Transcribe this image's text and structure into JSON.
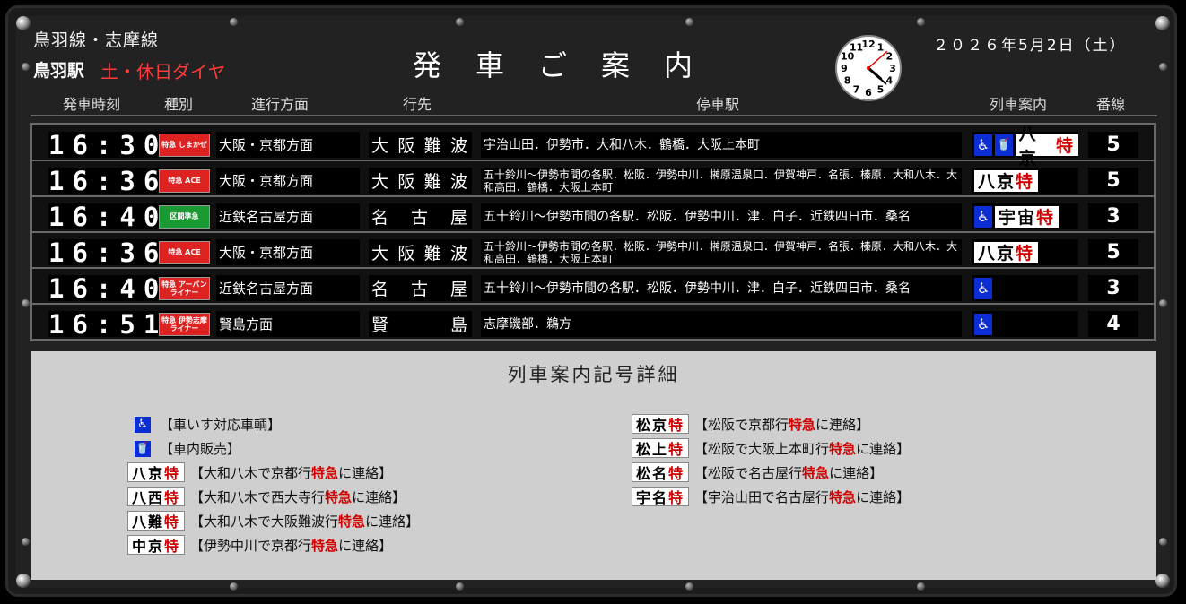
{
  "header": {
    "line_name": "鳥羽線・志摩線",
    "station": "鳥羽駅",
    "schedule": "土・休日ダイヤ",
    "title": "発車ご案内",
    "date": "２０２６年5月2日（土）"
  },
  "clock": {
    "numbers": [
      "12",
      "1",
      "2",
      "3",
      "4",
      "5",
      "6",
      "7",
      "8",
      "9",
      "10",
      "11"
    ],
    "hour": 4,
    "minute": 22,
    "second": 8
  },
  "columns": {
    "time": "発車時刻",
    "type": "種別",
    "direction": "進行方面",
    "destination": "行先",
    "stops": "停車駅",
    "info": "列車案内",
    "track": "番線"
  },
  "departures": [
    {
      "time": "16:30",
      "type_label": "特急 しまかぜ",
      "direction": "大阪・京都方面",
      "destination": "大阪難波",
      "stops": "宇治山田．伊勢市．大和八木．鶴橋．大阪上本町",
      "info": [
        "車いす",
        "車内販売",
        "八京特"
      ],
      "track": "5"
    },
    {
      "time": "16:36",
      "type_label": "特急 ACE",
      "direction": "大阪・京都方面",
      "destination": "大阪難波",
      "stops": "五十鈴川～伊勢市間の各駅．松阪．伊勢中川．榊原温泉口．伊賀神戸．名張．榛原．大和八木．大和高田．鶴橋．大阪上本町",
      "info": [
        "八京特"
      ],
      "track": "5"
    },
    {
      "time": "16:40",
      "type_label": "区間準急",
      "direction": "近鉄名古屋方面",
      "destination": "名古屋",
      "stops": "五十鈴川～伊勢市間の各駅．松阪．伊勢中川．津．白子．近鉄四日市．桑名",
      "info": [
        "車いす",
        "宇宙特"
      ],
      "track": "3"
    },
    {
      "time": "16:36",
      "type_label": "特急 ACE",
      "direction": "大阪・京都方面",
      "destination": "大阪難波",
      "stops": "五十鈴川～伊勢市間の各駅．松阪．伊勢中川．榊原温泉口．伊賀神戸．名張．榛原．大和八木．大和高田．鶴橋．大阪上本町",
      "info": [
        "八京特"
      ],
      "track": "5"
    },
    {
      "time": "16:40",
      "type_label": "特急 アーバンライナー",
      "direction": "近鉄名古屋方面",
      "destination": "名古屋",
      "stops": "五十鈴川～伊勢市間の各駅．松阪．伊勢中川．津．白子．近鉄四日市．桑名",
      "info": [
        "車いす"
      ],
      "track": "3"
    },
    {
      "time": "16:51",
      "type_label": "特急 伊勢志摩ライナー",
      "direction": "賢島方面",
      "destination": "賢島",
      "stops": "志摩磯部．鵜方",
      "info": [
        "車いす"
      ],
      "track": "4"
    }
  ],
  "legend": {
    "title": "列車案内記号詳細",
    "wheelchair": "【車いす対応車輌】",
    "vending": "【車内販売】",
    "items_left": [
      {
        "code_a": "八京",
        "code_b": "特",
        "text_a": "【大和八木で京都行",
        "text_em": "特急",
        "text_b": "に連絡】"
      },
      {
        "code_a": "八西",
        "code_b": "特",
        "text_a": "【大和八木で西大寺行",
        "text_em": "特急",
        "text_b": "に連絡】"
      },
      {
        "code_a": "八難",
        "code_b": "特",
        "text_a": "【大和八木で大阪難波行",
        "text_em": "特急",
        "text_b": "に連絡】"
      },
      {
        "code_a": "中京",
        "code_b": "特",
        "text_a": "【伊勢中川で京都行",
        "text_em": "特急",
        "text_b": "に連絡】"
      }
    ],
    "items_right": [
      {
        "code_a": "松京",
        "code_b": "特",
        "text_a": "【松阪で京都行",
        "text_em": "特急",
        "text_b": "に連絡】"
      },
      {
        "code_a": "松上",
        "code_b": "特",
        "text_a": "【松阪で大阪上本町行",
        "text_em": "特急",
        "text_b": "に連絡】"
      },
      {
        "code_a": "松名",
        "code_b": "特",
        "text_a": "【松阪で名古屋行",
        "text_em": "特急",
        "text_b": "に連絡】"
      },
      {
        "code_a": "宇名",
        "code_b": "特",
        "text_a": "【宇治山田で名古屋行",
        "text_em": "特急",
        "text_b": "に連絡】"
      }
    ]
  },
  "colors": {
    "schedule_red": "#ff3b3b",
    "accent_red": "#d10000",
    "wheelchair_blue": "#0a2dd4",
    "legend_bg": "#cfcfcf"
  }
}
